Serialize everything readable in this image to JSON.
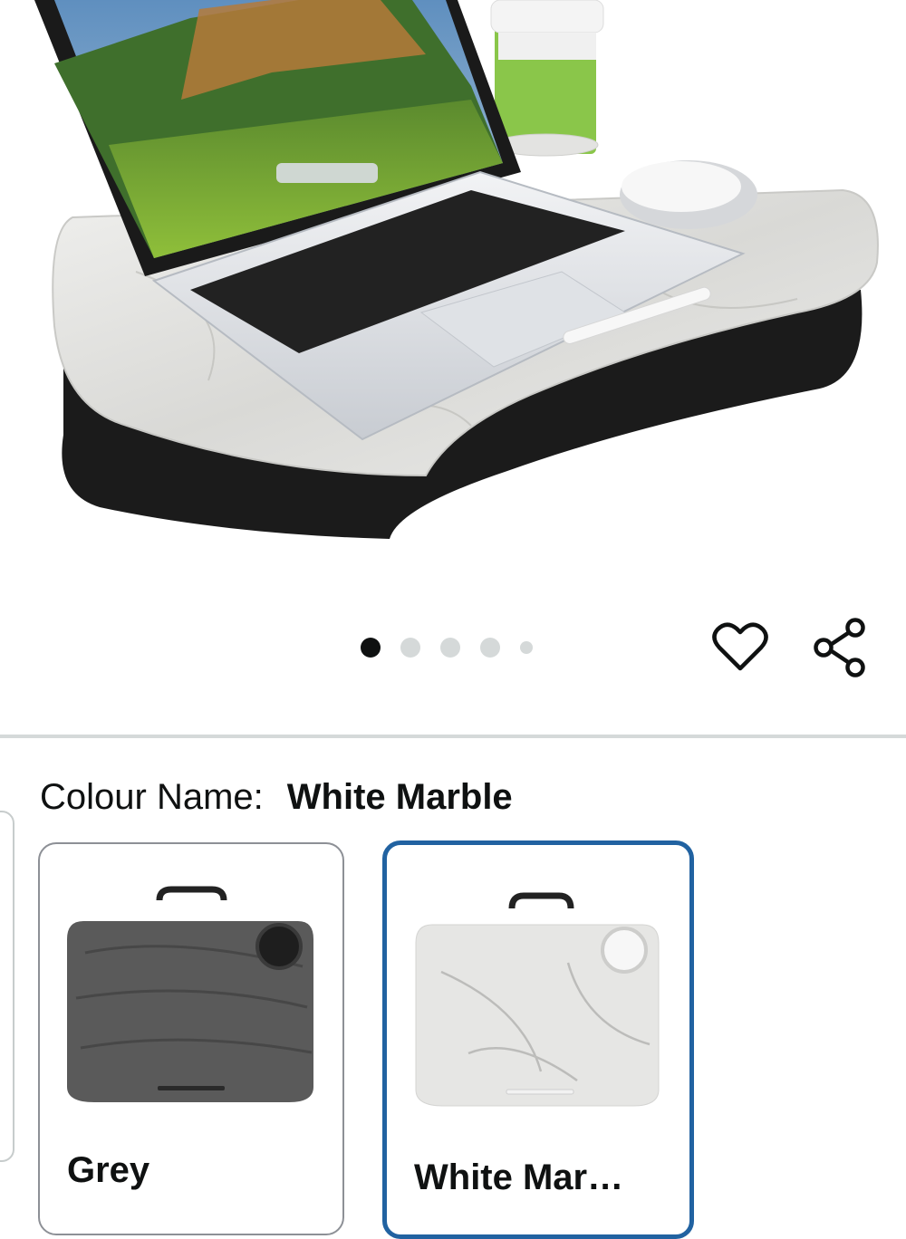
{
  "hero": {
    "image": "laptop-lap-desk-product-photo"
  },
  "carousel": {
    "total": 5,
    "active_index": 0
  },
  "actions": {
    "favorite_icon": "heart-icon",
    "share_icon": "share-icon"
  },
  "colour": {
    "label": "Colour Name:",
    "selected": "White Marble"
  },
  "swatches": [
    {
      "label": "Grey",
      "selected": false,
      "color": "#5a5a5a"
    },
    {
      "label": "White Mar…",
      "selected": true,
      "color": "#e6e6e6"
    }
  ],
  "colors": {
    "selected_border": "#2162a1",
    "divider": "#d5d9d9"
  }
}
